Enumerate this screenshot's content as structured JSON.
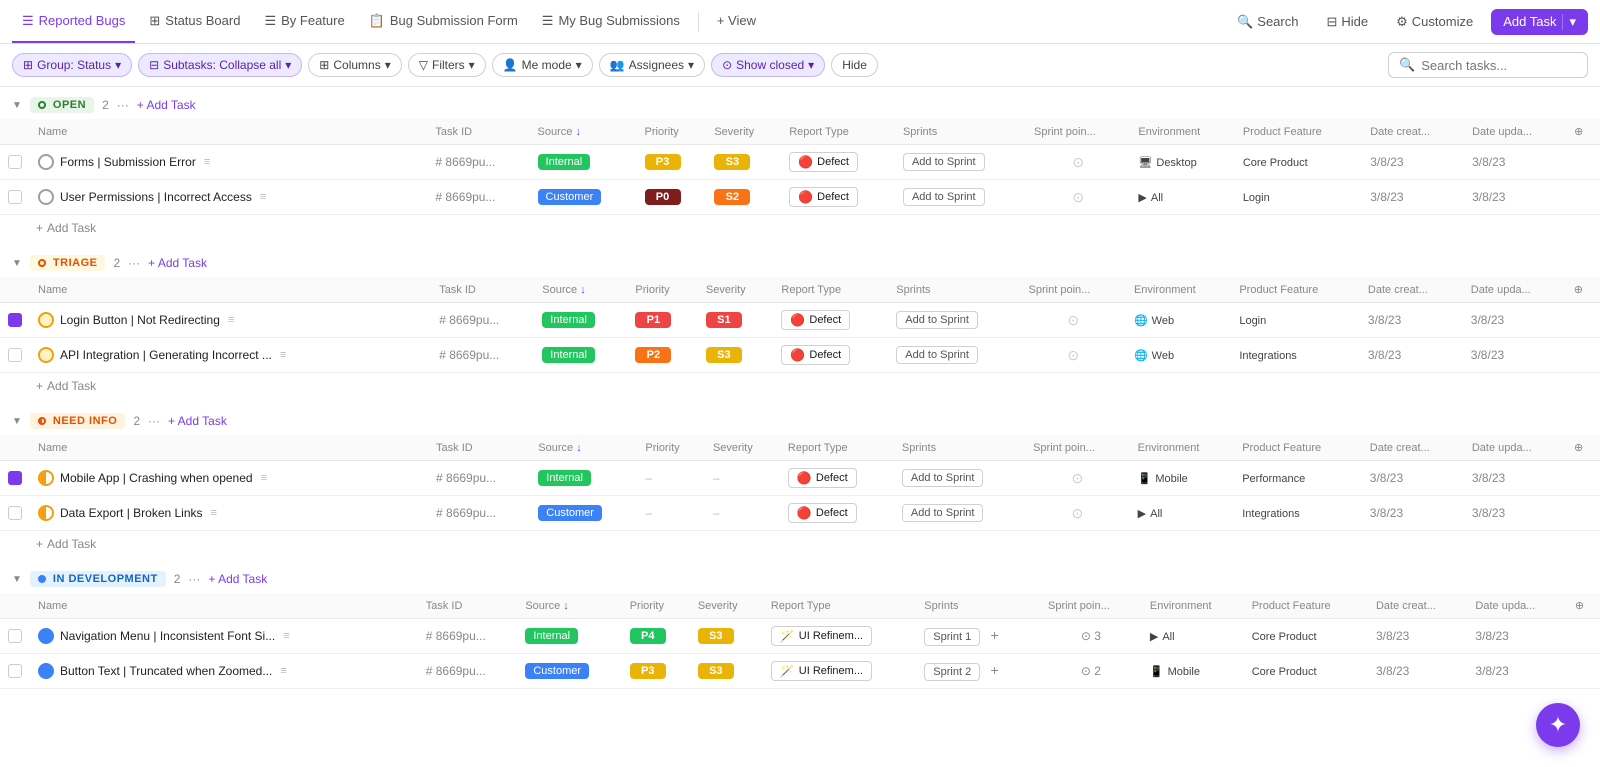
{
  "nav": {
    "tabs": [
      {
        "label": "Reported Bugs",
        "icon": "list-icon",
        "active": true
      },
      {
        "label": "Status Board",
        "icon": "board-icon",
        "active": false
      },
      {
        "label": "By Feature",
        "icon": "feature-icon",
        "active": false
      },
      {
        "label": "Bug Submission Form",
        "icon": "form-icon",
        "active": false
      },
      {
        "label": "My Bug Submissions",
        "icon": "mybugs-icon",
        "active": false
      },
      {
        "label": "+ View",
        "icon": null,
        "active": false
      }
    ],
    "right": {
      "search": "Search",
      "hide": "Hide",
      "customize": "Customize",
      "add_task": "Add Task"
    }
  },
  "toolbar": {
    "chips": [
      {
        "label": "Group: Status",
        "icon": "group-icon",
        "active": true
      },
      {
        "label": "Subtasks: Collapse all",
        "icon": "subtask-icon",
        "active": true
      },
      {
        "label": "Columns",
        "icon": "columns-icon",
        "active": false
      },
      {
        "label": "Filters",
        "icon": "filter-icon",
        "active": false
      },
      {
        "label": "Me mode",
        "icon": "me-icon",
        "active": false
      },
      {
        "label": "Assignees",
        "icon": "assignee-icon",
        "active": false
      },
      {
        "label": "Show closed",
        "icon": "show-icon",
        "active": true
      }
    ],
    "hide_label": "Hide",
    "search_placeholder": "Search tasks..."
  },
  "groups": [
    {
      "id": "open",
      "status": "OPEN",
      "status_class": "status-open",
      "count": 2,
      "columns": [
        "Name",
        "Task ID",
        "Source",
        "Priority",
        "Severity",
        "Report Type",
        "Sprints",
        "Sprint poin...",
        "Environment",
        "Product Feature",
        "Date creat...",
        "Date upda..."
      ],
      "rows": [
        {
          "name": "Forms | Submission Error",
          "icon_class": "icon-circle-grey",
          "task_id": "# 8669pu...",
          "source": "Internal",
          "source_class": "source-internal",
          "priority": "P3",
          "priority_class": "p3",
          "severity": "S3",
          "severity_class": "s3",
          "report_type": "Defect",
          "report_icon": "🔴",
          "sprints": "Add to Sprint",
          "sprint_points": "",
          "environment": "Desktop",
          "env_icon": "🖥",
          "product_feature": "Core Product",
          "date_created": "3/8/23",
          "date_updated": "3/8/23",
          "checkbox": false
        },
        {
          "name": "User Permissions | Incorrect Access",
          "icon_class": "icon-circle-grey",
          "task_id": "# 8669pu...",
          "source": "Customer",
          "source_class": "source-customer",
          "priority": "P0",
          "priority_class": "p0",
          "severity": "S2",
          "severity_class": "s2",
          "report_type": "Defect",
          "report_icon": "🔴",
          "sprints": "Add to Sprint",
          "sprint_points": "",
          "environment": "All",
          "env_icon": "▶",
          "product_feature": "Login",
          "date_created": "3/8/23",
          "date_updated": "3/8/23",
          "checkbox": false
        }
      ]
    },
    {
      "id": "triage",
      "status": "TRIAGE",
      "status_class": "status-triage",
      "count": 2,
      "columns": [
        "Name",
        "Task ID",
        "Source",
        "Priority",
        "Severity",
        "Report Type",
        "Sprints",
        "Sprint poin...",
        "Environment",
        "Product Feature",
        "Date creat...",
        "Date upda..."
      ],
      "rows": [
        {
          "name": "Login Button | Not Redirecting",
          "icon_class": "icon-circle-yellow",
          "task_id": "# 8669pu...",
          "source": "Internal",
          "source_class": "source-internal",
          "priority": "P1",
          "priority_class": "p1",
          "severity": "S1",
          "severity_class": "s1",
          "report_type": "Defect",
          "report_icon": "🔴",
          "sprints": "Add to Sprint",
          "sprint_points": "",
          "environment": "Web",
          "env_icon": "🌐",
          "product_feature": "Login",
          "date_created": "3/8/23",
          "date_updated": "3/8/23",
          "checkbox": true
        },
        {
          "name": "API Integration | Generating Incorrect ...",
          "icon_class": "icon-circle-yellow",
          "task_id": "# 8669pu...",
          "source": "Internal",
          "source_class": "source-internal",
          "priority": "P2",
          "priority_class": "p2",
          "severity": "S3",
          "severity_class": "s3",
          "report_type": "Defect",
          "report_icon": "🔴",
          "sprints": "Add to Sprint",
          "sprint_points": "",
          "environment": "Web",
          "env_icon": "🌐",
          "product_feature": "Integrations",
          "date_created": "3/8/23",
          "date_updated": "3/8/23",
          "checkbox": false
        }
      ]
    },
    {
      "id": "need-info",
      "status": "NEED INFO",
      "status_class": "status-need-info",
      "count": 2,
      "columns": [
        "Name",
        "Task ID",
        "Source",
        "Priority",
        "Severity",
        "Report Type",
        "Sprints",
        "Sprint poin...",
        "Environment",
        "Product Feature",
        "Date creat...",
        "Date upda..."
      ],
      "rows": [
        {
          "name": "Mobile App | Crashing when opened",
          "icon_class": "icon-circle-yellow-half",
          "task_id": "# 8669pu...",
          "source": "Internal",
          "source_class": "source-internal",
          "priority": "–",
          "priority_class": "",
          "severity": "–",
          "severity_class": "",
          "report_type": "Defect",
          "report_icon": "🔴",
          "sprints": "Add to Sprint",
          "sprint_points": "",
          "environment": "Mobile",
          "env_icon": "📱",
          "product_feature": "Performance",
          "date_created": "3/8/23",
          "date_updated": "3/8/23",
          "checkbox": true
        },
        {
          "name": "Data Export | Broken Links",
          "icon_class": "icon-circle-yellow-half",
          "task_id": "# 8669pu...",
          "source": "Customer",
          "source_class": "source-customer",
          "priority": "–",
          "priority_class": "",
          "severity": "–",
          "severity_class": "",
          "report_type": "Defect",
          "report_icon": "🔴",
          "sprints": "Add to Sprint",
          "sprint_points": "",
          "environment": "All",
          "env_icon": "▶",
          "product_feature": "Integrations",
          "date_created": "3/8/23",
          "date_updated": "3/8/23",
          "checkbox": false
        }
      ]
    },
    {
      "id": "in-development",
      "status": "IN DEVELOPMENT",
      "status_class": "status-in-dev",
      "count": 2,
      "columns": [
        "Name",
        "Task ID",
        "Source",
        "Priority",
        "Severity",
        "Report Type",
        "Sprints",
        "Sprint poin...",
        "Environment",
        "Product Feature",
        "Date creat...",
        "Date upda..."
      ],
      "rows": [
        {
          "name": "Navigation Menu | Inconsistent Font Si...",
          "icon_class": "icon-circle-blue-full",
          "task_id": "# 8669pu...",
          "source": "Internal",
          "source_class": "source-internal",
          "priority": "P4",
          "priority_class": "p4",
          "severity": "S3",
          "severity_class": "s3",
          "report_type": "UI Refinem...",
          "report_icon": "ui",
          "sprints": "Sprint 1",
          "sprint_points": "3",
          "environment": "All",
          "env_icon": "▶",
          "product_feature": "Core Product",
          "date_created": "3/8/23",
          "date_updated": "3/8/23",
          "checkbox": false
        },
        {
          "name": "Button Text | Truncated when Zoomed...",
          "icon_class": "icon-circle-blue-full",
          "task_id": "# 8669pu...",
          "source": "Customer",
          "source_class": "source-customer",
          "priority": "P3",
          "priority_class": "p3",
          "severity": "S3",
          "severity_class": "s3",
          "report_type": "UI Refinem...",
          "report_icon": "ui",
          "sprints": "Sprint 2",
          "sprint_points": "2",
          "environment": "Mobile",
          "env_icon": "📱",
          "product_feature": "Core Product",
          "date_created": "3/8/23",
          "date_updated": "3/8/23",
          "checkbox": false
        }
      ]
    }
  ]
}
